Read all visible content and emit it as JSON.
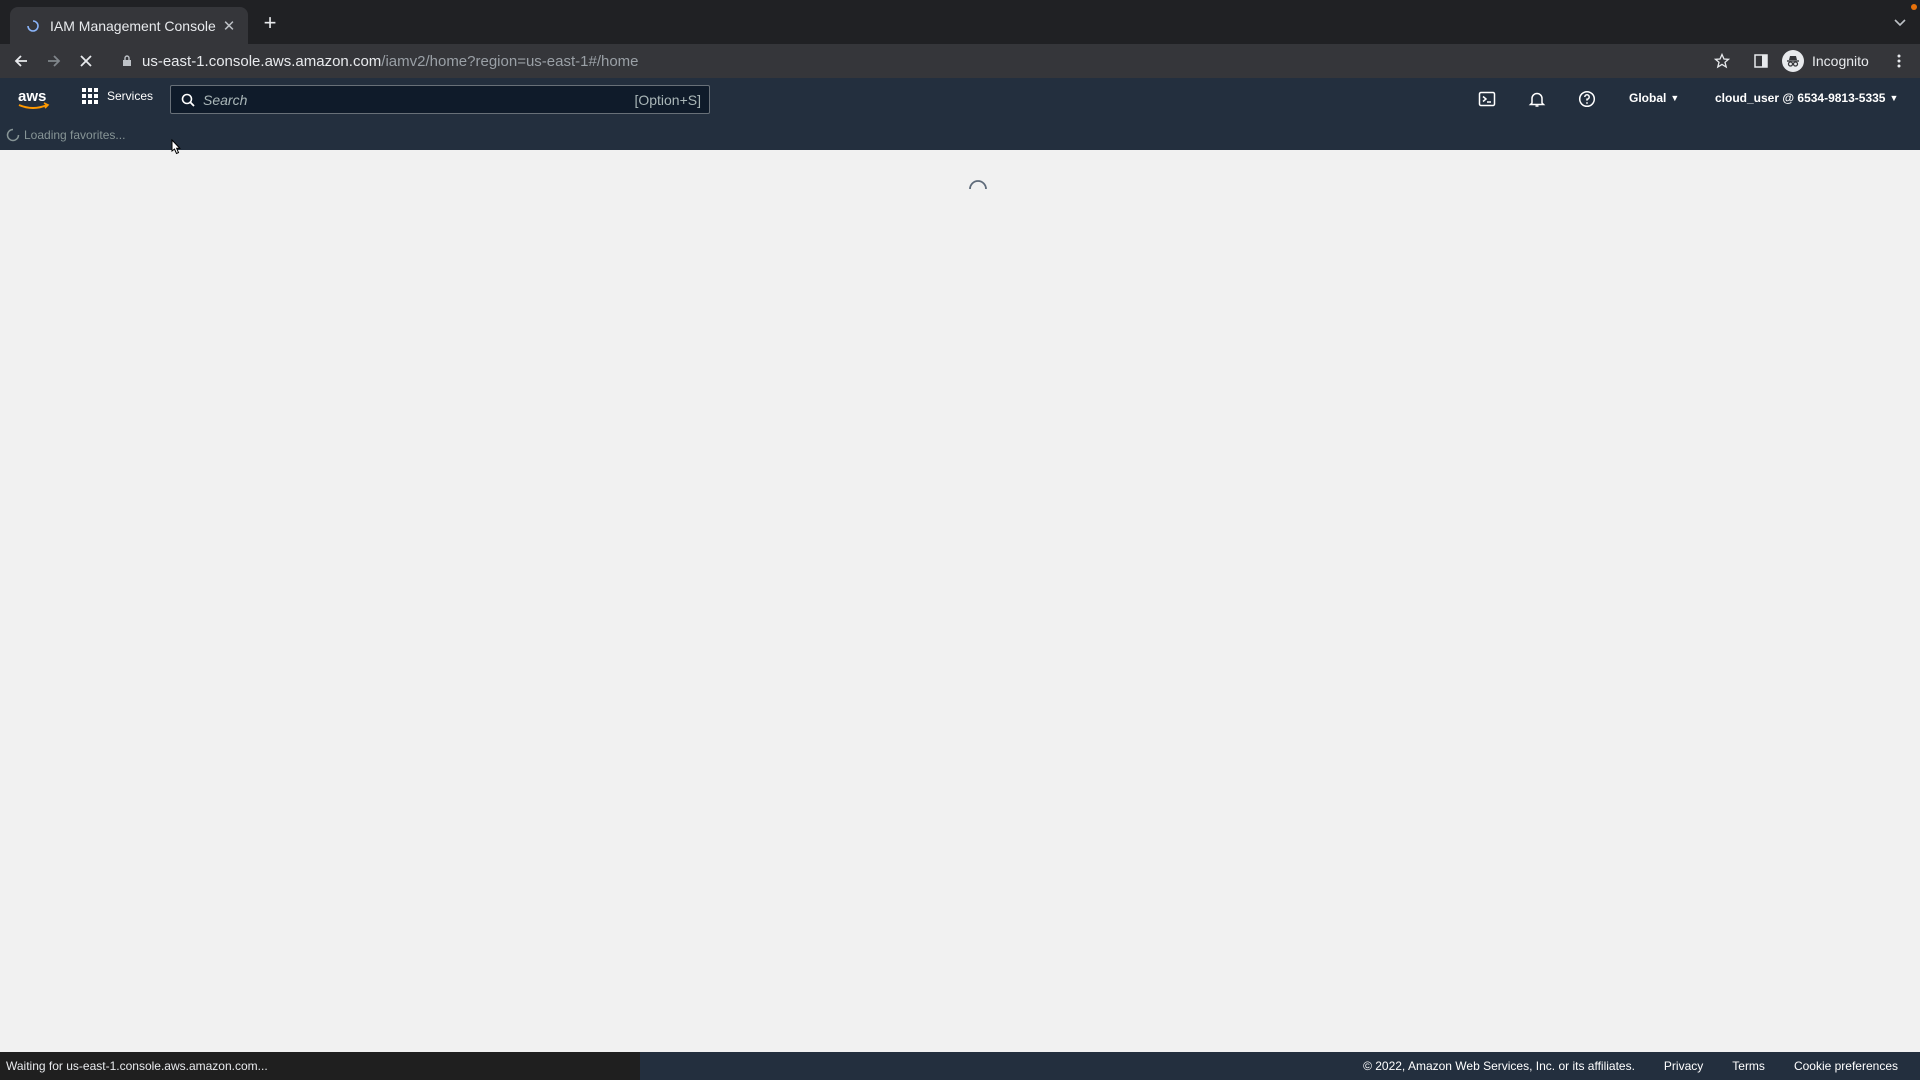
{
  "browser": {
    "tab_title": "IAM Management Console",
    "url_host": "us-east-1.console.aws.amazon.com",
    "url_path": "/iamv2/home?region=us-east-1#/home",
    "profile_label": "Incognito"
  },
  "awsnav": {
    "services_label": "Services",
    "search_placeholder": "Search",
    "search_shortcut": "[Option+S]",
    "region_label": "Global",
    "account_label": "cloud_user @ 6534-9813-5335"
  },
  "favorites": {
    "loading_text": "Loading favorites..."
  },
  "status": {
    "text": "Waiting for us-east-1.console.aws.amazon.com..."
  },
  "footer": {
    "copyright": "© 2022, Amazon Web Services, Inc. or its affiliates.",
    "privacy": "Privacy",
    "terms": "Terms",
    "cookie": "Cookie preferences"
  },
  "colors": {
    "aws_nav_bg": "#232f3e",
    "browser_frame": "#202124",
    "content_bg": "#f1f1f1"
  }
}
